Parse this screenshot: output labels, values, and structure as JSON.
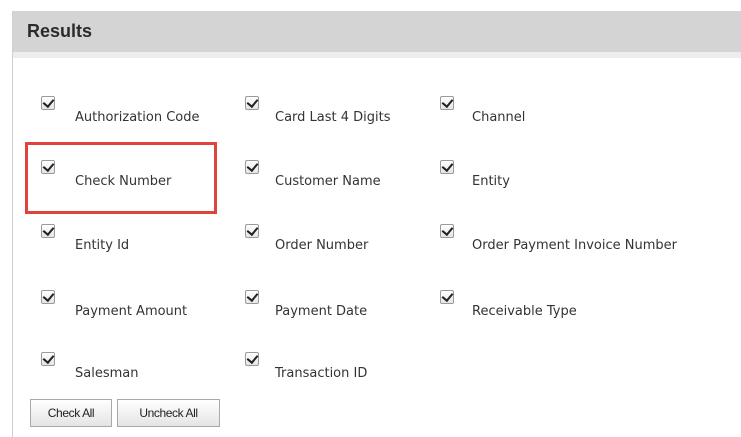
{
  "panel": {
    "title": "Results"
  },
  "options": [
    {
      "label": "Authorization Code",
      "checked": true
    },
    {
      "label": "Card Last 4 Digits",
      "checked": true
    },
    {
      "label": "Channel",
      "checked": true
    },
    {
      "label": "Check Number",
      "checked": true,
      "highlighted": true
    },
    {
      "label": "Customer Name",
      "checked": true
    },
    {
      "label": "Entity",
      "checked": true
    },
    {
      "label": "Entity Id",
      "checked": true
    },
    {
      "label": "Order Number",
      "checked": true
    },
    {
      "label": "Order Payment Invoice Number",
      "checked": true
    },
    {
      "label": "Payment Amount",
      "checked": true
    },
    {
      "label": "Payment Date",
      "checked": true
    },
    {
      "label": "Receivable Type",
      "checked": true
    },
    {
      "label": "Salesman",
      "checked": true
    },
    {
      "label": "Transaction ID",
      "checked": true
    }
  ],
  "buttons": {
    "check_all": "Check All",
    "uncheck_all": "Uncheck All"
  },
  "colors": {
    "header_bg": "#d4d4d4",
    "highlight_border": "#e0433b"
  }
}
